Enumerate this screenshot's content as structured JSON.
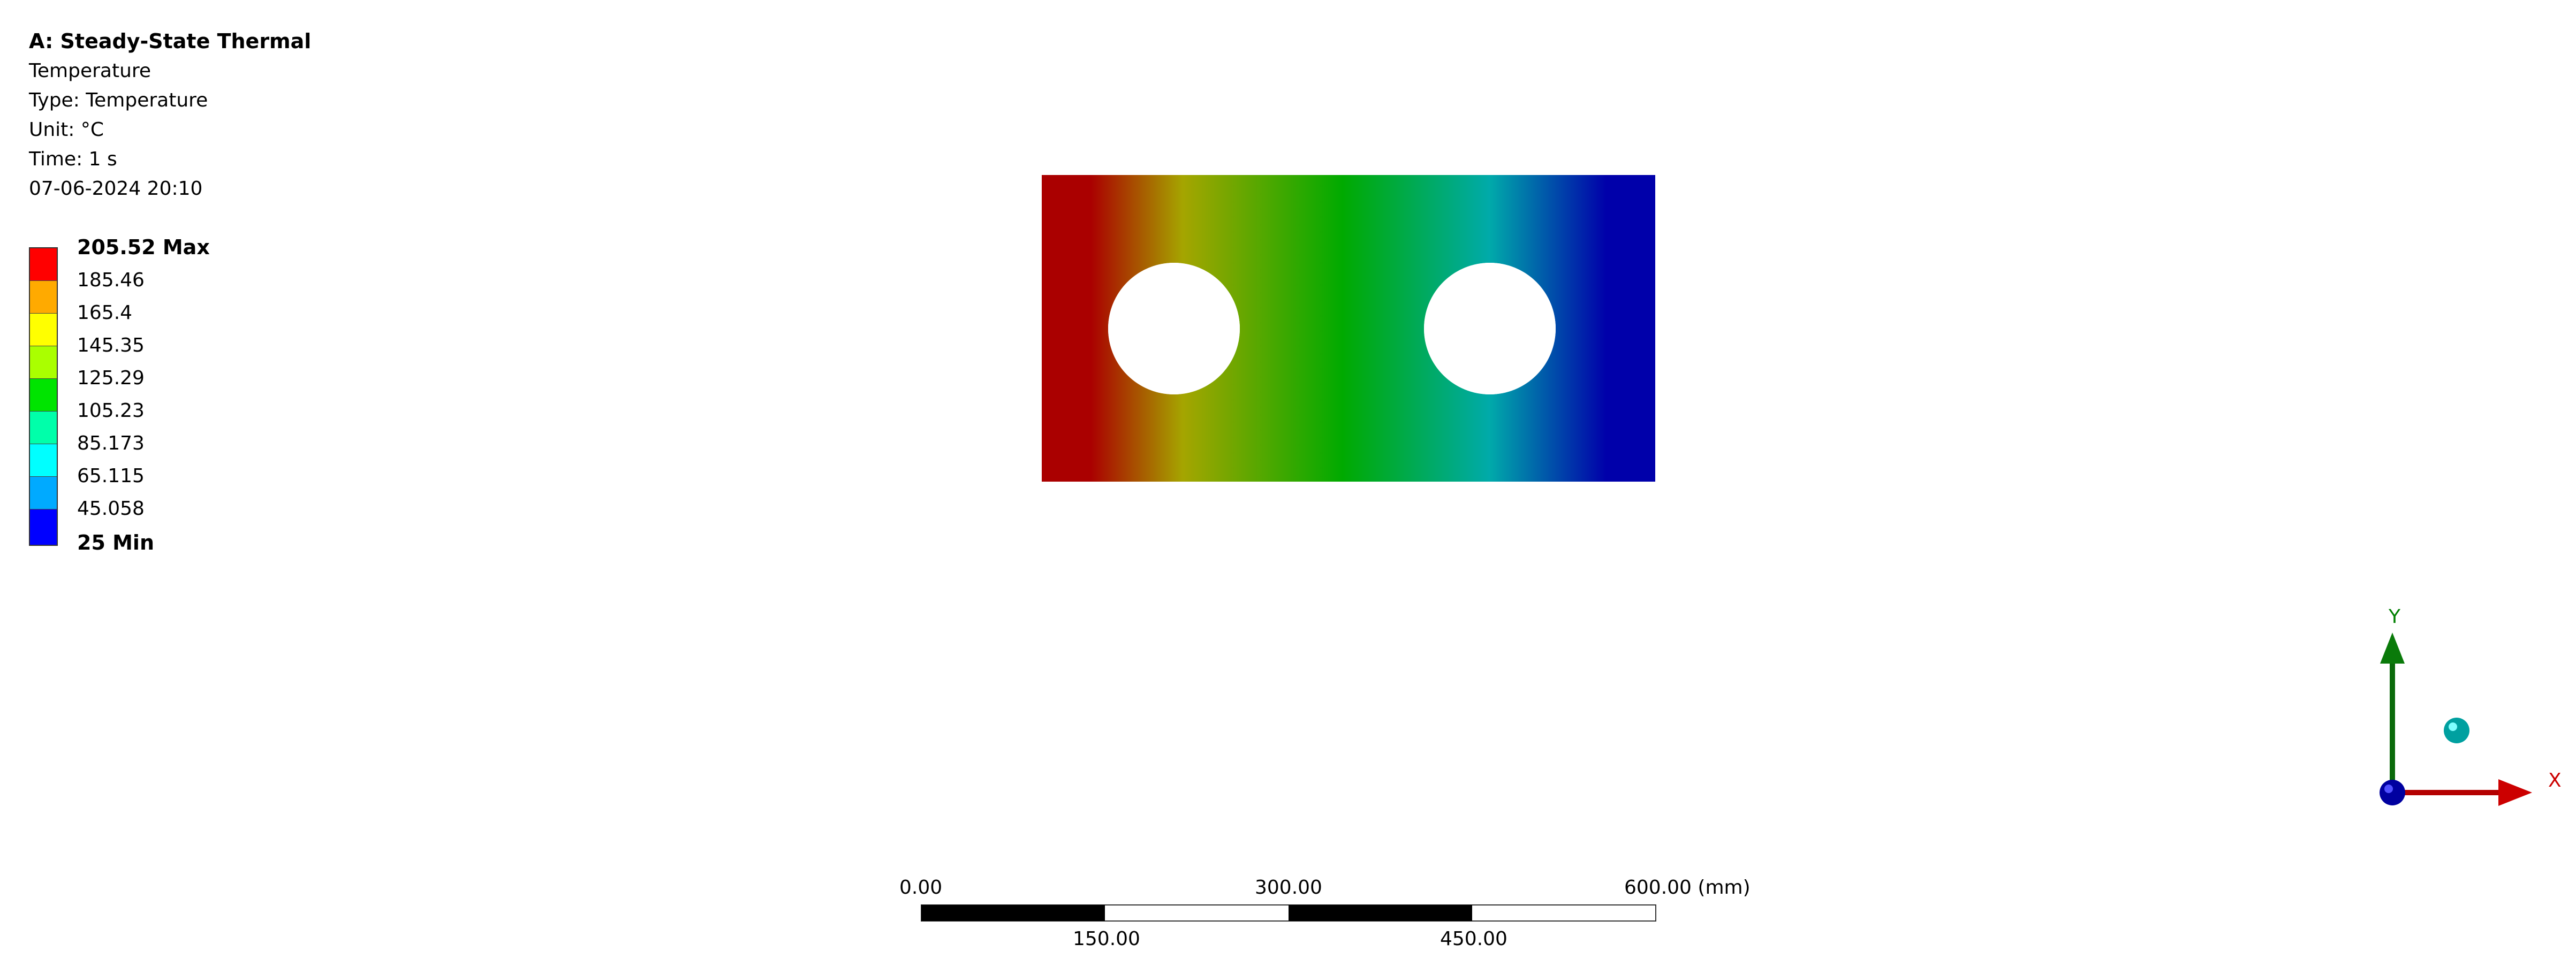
{
  "info": {
    "title": "A: Steady-State Thermal",
    "result": "Temperature",
    "type": "Type: Temperature",
    "unit": "Unit: °C",
    "time": "Time: 1 s",
    "timestamp": "07-06-2024 20:10"
  },
  "legend": {
    "labels": [
      "205.52 Max",
      "185.46",
      "165.4",
      "145.35",
      "125.29",
      "105.23",
      "85.173",
      "65.115",
      "45.058",
      "25 Min"
    ],
    "colors": [
      "#ff0000",
      "#ffaa00",
      "#ffff00",
      "#aaff00",
      "#00e400",
      "#00ffaa",
      "#00ffff",
      "#00aaff",
      "#0000ff"
    ]
  },
  "model": {
    "gradient": [
      "#aa0000",
      "#a5a500",
      "#00aa00",
      "#00aaaa",
      "#0000aa"
    ]
  },
  "triad": {
    "x_label": "X",
    "y_label": "Y",
    "x_color": "#cc0000",
    "y_color": "#008000"
  },
  "scale": {
    "top_labels": [
      "0.00",
      "300.00",
      "600.00 (mm)"
    ],
    "bottom_labels": [
      "150.00",
      "450.00"
    ]
  }
}
